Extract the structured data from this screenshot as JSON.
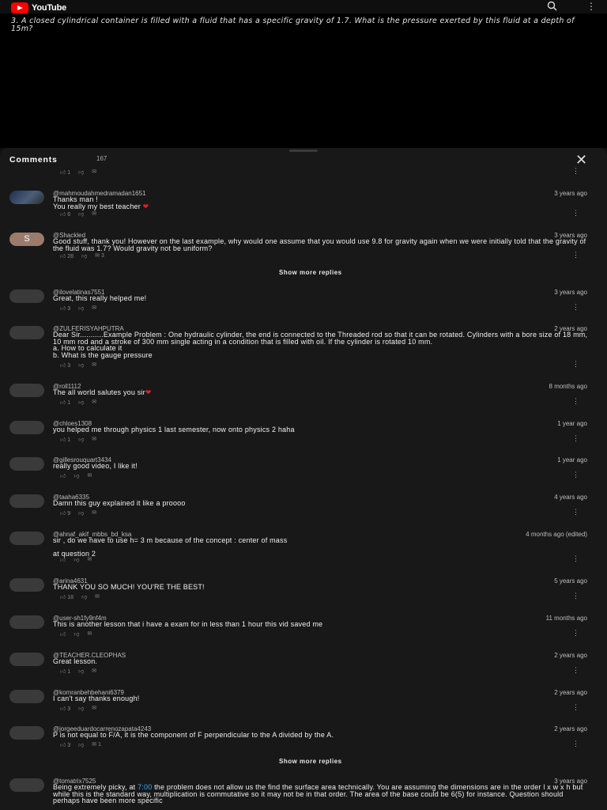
{
  "app": {
    "name": "YouTube"
  },
  "video": {
    "question": "3.  A closed cylindrical container is filled with a fluid that has a specific gravity of 1.7.  What is the pressure exerted by this fluid at a depth of 15m?"
  },
  "comments_panel": {
    "title": "Comments",
    "count": "167",
    "show_more_label": "Show more replies"
  },
  "top_actions": {
    "likes": "1"
  },
  "comments": [
    {
      "handle": "@mahmoudahmedramadan1651",
      "time": "3 years ago",
      "text": "Thanks man !\nYou really my best teacher",
      "likes": "6",
      "heart": true
    },
    {
      "handle": "@Shackled",
      "time": "3 years ago",
      "text": "Good stuff, thank you! However on the last example, why would one assume that you would use 9.8 for gravity again when we were initially told that the gravity of the fluid was 1.7? Would gravity not be uniform?",
      "likes": "28",
      "replies": "3",
      "avatar_letter": "S"
    },
    {
      "handle": "@ilovelatinas7551",
      "time": "3 years ago",
      "text": "Great, this really helped me!",
      "likes": "3"
    },
    {
      "handle": "@ZULFERISYAHPUTRA",
      "time": "2 years ago",
      "text": "Dear Sir...........Example Problem : One hydraulic cylinder, the end is connected to the Threaded rod so that it can be rotated. Cylinders with a bore size of 18 mm, 10 mm rod and a stroke of 300 mm single acting in a condition that is filled with oil. If the cylinder is rotated 10 mm.\na. How to calculate it\nb. What is the gauge pressure",
      "likes": "3"
    },
    {
      "handle": "@roll1112",
      "time": "8 months ago",
      "text": "The all world salutes you sir",
      "likes": "1",
      "heart": true
    },
    {
      "handle": "@chloes1308",
      "time": "1 year ago",
      "text": "you helped me through physics 1 last semester, now onto physics 2 haha",
      "likes": "1"
    },
    {
      "handle": "@gillesrouquart3434",
      "time": "1 year ago",
      "text": "really good video, I like it!",
      "likes": ""
    },
    {
      "handle": "@taaha6335",
      "time": "4 years ago",
      "text": "Damn this guy explained it like a proooo",
      "likes": "9"
    },
    {
      "handle": "@ahnaf_akif_mbbs_bd_ksa",
      "time": "4 months ago (edited)",
      "text": "sir , do we have to use h= 3 m because of the concept : center of mass\n\nat question 2",
      "likes": ""
    },
    {
      "handle": "@arina4631",
      "time": "5 years ago",
      "text": "THANK YOU SO MUCH! YOU'RE THE BEST!",
      "likes": "18"
    },
    {
      "handle": "@user-sh1fy9nf4m",
      "time": "11 months ago",
      "text": "This is another lesson that i have a exam for in less than 1 hour this vid saved me",
      "likes": ""
    },
    {
      "handle": "@TEACHER.CLEOPHAS",
      "time": "2 years ago",
      "text": "Great lesson.",
      "likes": "1"
    },
    {
      "handle": "@komranbehbehani6379",
      "time": "2 years ago",
      "text": "I can't say thanks enough!",
      "likes": "3"
    },
    {
      "handle": "@jorgeeduardocarrenozapata4243",
      "time": "2 years ago",
      "text": "P is not equal to F/A, it is the component of F perpendicular to the A divided by the A.",
      "likes": "3",
      "replies": "1"
    },
    {
      "handle": "@tomatrix7525",
      "time": "3 years ago",
      "text_before_link": "Being extremely picky, at ",
      "link": "7:00",
      "text_after_link": " the problem does not allow us the find the surface area technically. You are assuming the dimensions are in the order l x w x h but while this is the standard way, multiplication is commutative so it may not be in that order. The area of the base could be 6(5) for instance. Question should perhaps have been more specific"
    }
  ]
}
